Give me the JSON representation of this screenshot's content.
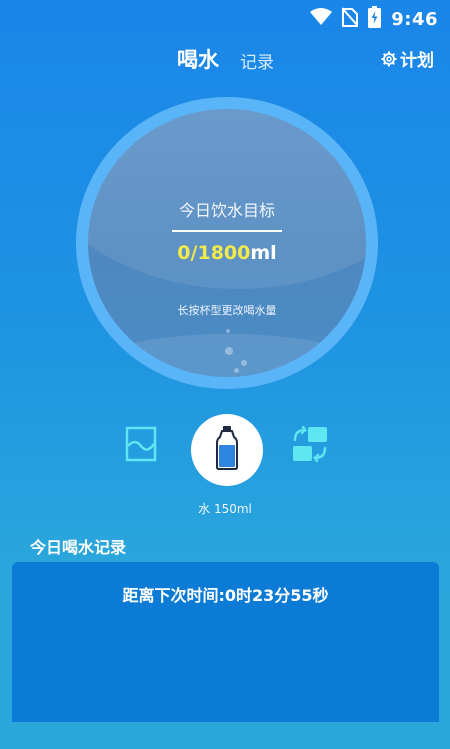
{
  "status_bar": {
    "time": "9:46",
    "icons": [
      "wifi-icon",
      "no-sim-icon",
      "battery-charging-icon"
    ]
  },
  "header": {
    "tabs": [
      {
        "label": "喝水",
        "active": true
      },
      {
        "label": "记录",
        "active": false
      }
    ],
    "plan_label": "计划",
    "plan_icon": "gear-icon"
  },
  "goal": {
    "title": "今日饮水目标",
    "current": "0",
    "separator": "/",
    "target": "1800",
    "unit": "ml",
    "hint": "长按杯型更改喝水量"
  },
  "cups": {
    "left_icon": "glass-icon",
    "selected_icon": "water-bottle-icon",
    "right_icon": "switch-icon",
    "selected_label": "水 150ml"
  },
  "record": {
    "title": "今日喝水记录",
    "next_time": "距离下次时间:0时23分55秒"
  },
  "colors": {
    "accent_yellow": "#f2ea4a",
    "ring": "#5ab4f8",
    "card": "#0b7bd6",
    "icon_cyan": "#5ee6f2"
  }
}
